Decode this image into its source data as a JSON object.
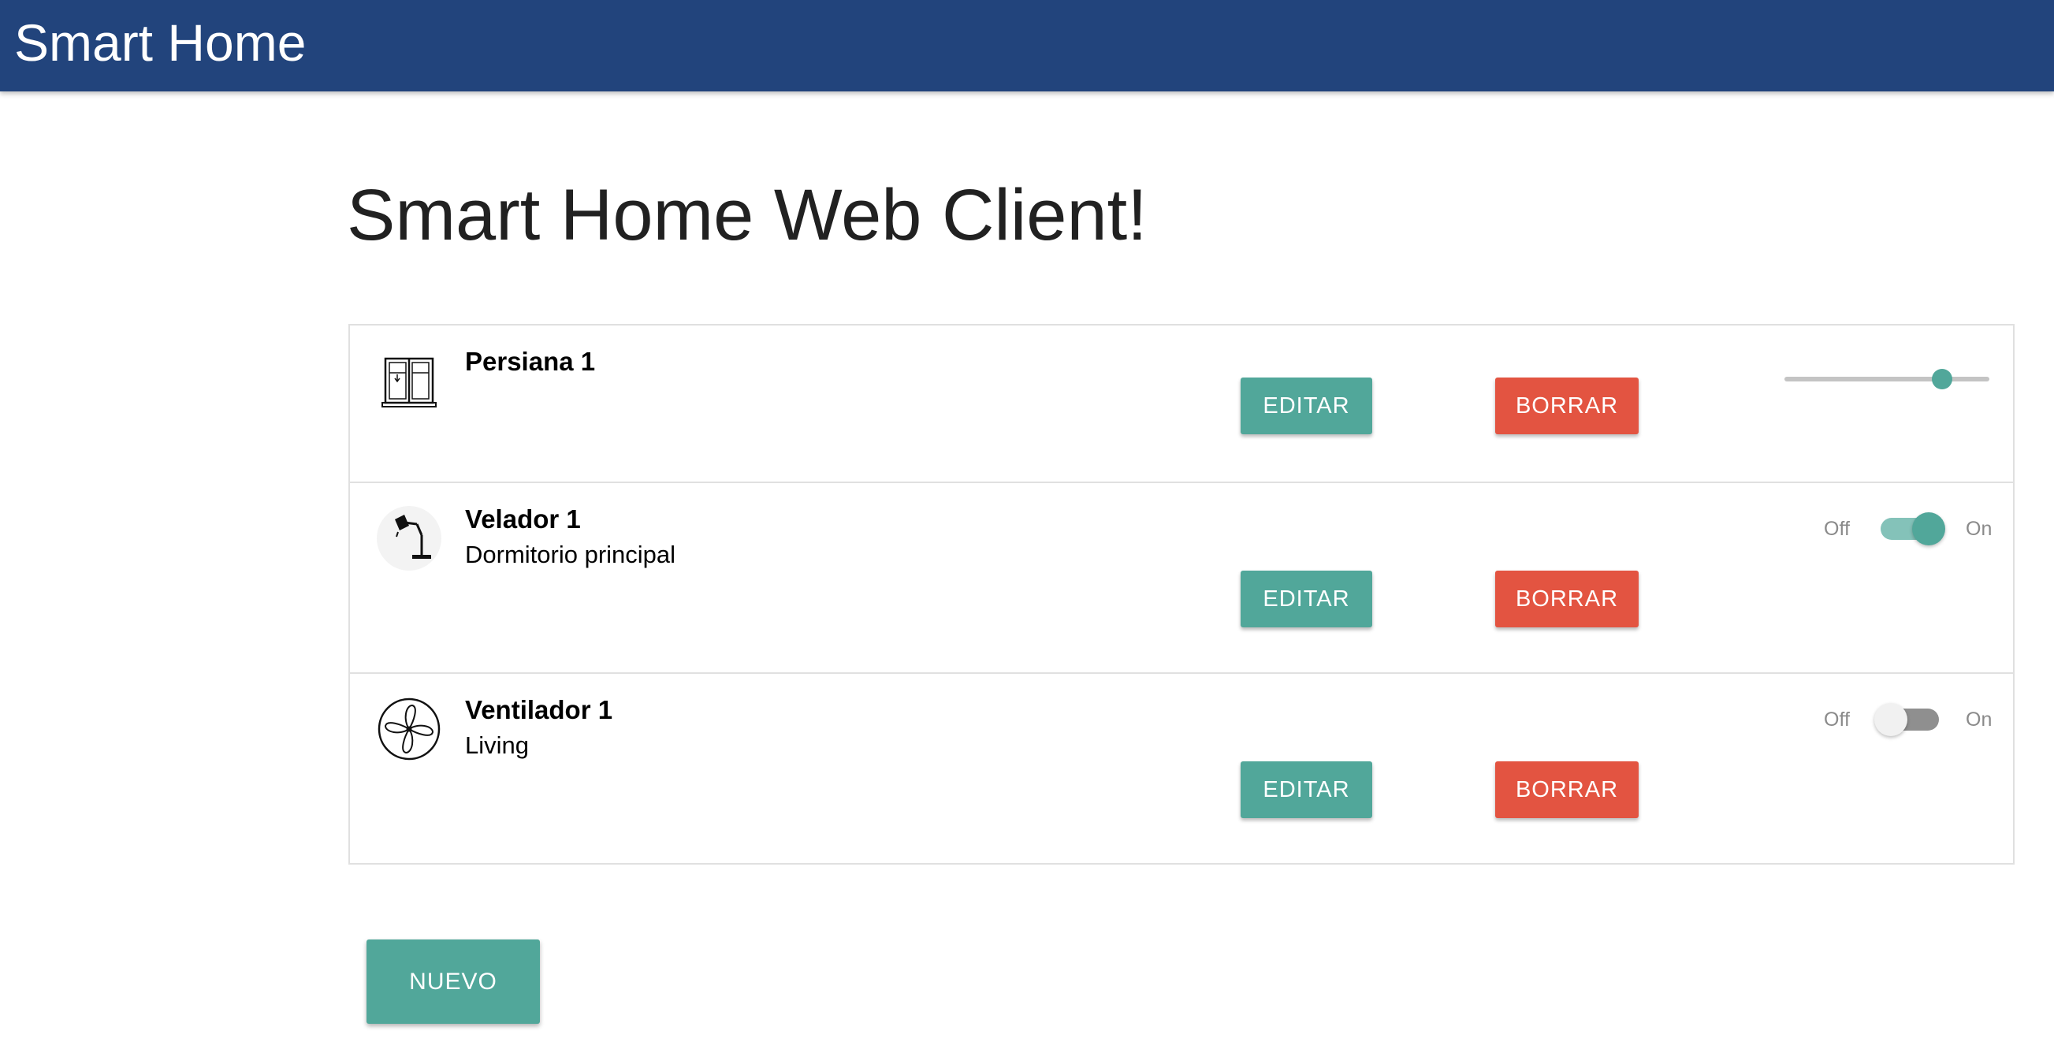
{
  "app": {
    "brand": "Smart Home"
  },
  "page": {
    "title": "Smart Home Web Client!"
  },
  "devices": [
    {
      "name": "Persiana 1",
      "description": "",
      "icon": "window-blind-icon",
      "control": "slider",
      "slider_value_percent": 77,
      "edit_label": "EDITAR",
      "delete_label": "BORRAR"
    },
    {
      "name": "Velador 1",
      "description": "Dormitorio principal",
      "icon": "desk-lamp-icon",
      "control": "switch",
      "switch_on": true,
      "off_label": "Off",
      "on_label": "On",
      "edit_label": "EDITAR",
      "delete_label": "BORRAR"
    },
    {
      "name": "Ventilador 1",
      "description": "Living",
      "icon": "fan-icon",
      "control": "switch",
      "switch_on": false,
      "off_label": "Off",
      "on_label": "On",
      "edit_label": "EDITAR",
      "delete_label": "BORRAR"
    }
  ],
  "actions": {
    "new_label": "NUEVO"
  },
  "colors": {
    "navbar": "#22447c",
    "edit_button": "#51a79a",
    "delete_button": "#e35441",
    "accent": "#51a79a"
  }
}
